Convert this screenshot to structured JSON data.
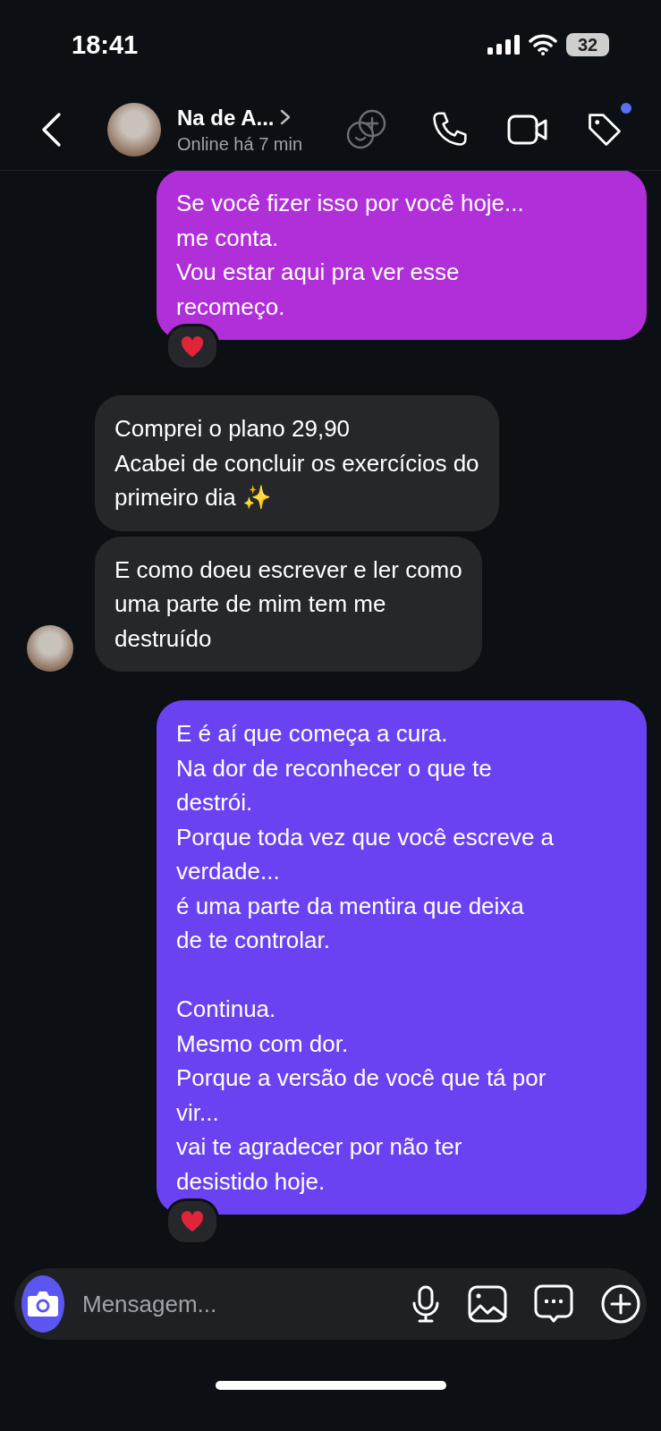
{
  "status_bar": {
    "time": "18:41",
    "battery": "32"
  },
  "header": {
    "name": "Na de A...",
    "presence": "Online há 7 min",
    "tag_notification": true
  },
  "messages": [
    {
      "kind": "sent",
      "color": "#b02fd8",
      "text": "Se você fizer isso por você hoje...\nme conta.\nVou estar aqui pra ver esse\nrecomeço.",
      "reacted": true,
      "avatar": false
    },
    {
      "kind": "received",
      "text": "Comprei o plano 29,90\nAcabei de concluir os exercícios do\nprimeiro dia ✨",
      "reacted": false,
      "avatar": false
    },
    {
      "kind": "received",
      "text": "E como doeu escrever e ler como\numa parte de mim tem me\ndestruído",
      "reacted": false,
      "avatar": true
    },
    {
      "kind": "sent",
      "color": "#6a42f2",
      "text": "E é aí que começa a cura.\nNa dor de reconhecer o que te\ndestrói.\nPorque toda vez que você escreve a\nverdade...\né uma parte da mentira que deixa\nde te controlar.\n\nContinua.\nMesmo com dor.\nPorque a versão de você que tá por\nvir...\nvai te agradecer por não ter\ndesistido hoje.",
      "reacted": true,
      "avatar": false
    }
  ],
  "composer": {
    "placeholder": "Mensagem..."
  }
}
